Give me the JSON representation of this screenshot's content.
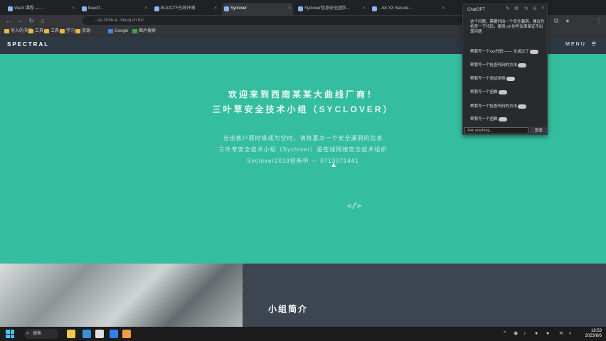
{
  "browser": {
    "tabs": [
      {
        "label": "Vue3 课程 — ...",
        "active": false
      },
      {
        "label": "buuctf...",
        "active": false
      },
      {
        "label": "BUUCTF在线评测",
        "active": false
      },
      {
        "label": "Syclover",
        "active": true
      },
      {
        "label": "Syclover信息安全团队...",
        "active": false
      },
      {
        "label": "...for XX Secure...",
        "active": false
      }
    ],
    "url": "...a2-2036-4...buuoj.cn:81/",
    "bookmarks": [
      {
        "label": "导入的书签"
      },
      {
        "label": "工具"
      },
      {
        "label": "工具"
      },
      {
        "label": "学习"
      },
      {
        "label": "资源"
      },
      {
        "label": "Google"
      },
      {
        "label": "图片搜索"
      }
    ]
  },
  "site": {
    "logo": "SPECTRAL",
    "menu_label": "MENU",
    "hero": {
      "title_line1": "欢迎来到西南某某大曲线厂商！",
      "title_line2": "三叶草安全技术小组（SYCLOVER）",
      "desc_line1": "当出客户面时吸或为空时，请将重点一个安全漏洞的信息",
      "desc_line2": "三叶草安全技术小组（Syclover）是在线网络安全技术组织",
      "desc_line3": "Syclover2019招新中 — 0713071441",
      "code_icon": "</>"
    },
    "section_title": "小组简介"
  },
  "extension": {
    "header": "ChatGPT",
    "intro": "这个问题，需要列出一个安全漏洞，建议先检查一下代码，使用 ctf 的写法来保证不出现问题",
    "items": [
      "帮我写一个xxx代码 —— 生成过了",
      "帮我写一个检查代码的方法",
      "帮我写一个测试用例",
      "帮我写一个函数",
      "帮我写一个检查代码的方法",
      "帮我写一个函数"
    ],
    "input_placeholder": "Ask anything...",
    "send_label": "发送"
  },
  "taskbar": {
    "search_label": "搜索",
    "time": "18:53",
    "date": "2023/8/6"
  }
}
